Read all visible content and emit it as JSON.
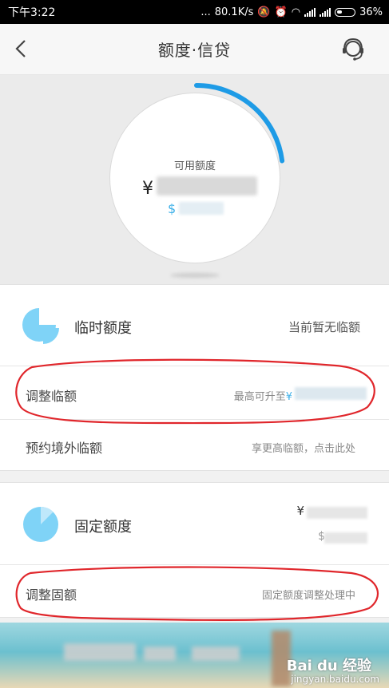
{
  "status_bar": {
    "time": "下午3:22",
    "dots": "...",
    "speed": "80.1K/s",
    "battery": "36%"
  },
  "header": {
    "title": "额度·信贷",
    "back_icon": "chevron-left-icon",
    "service_icon": "customer-service-icon"
  },
  "hero": {
    "label": "可用额度",
    "currency_cny": "¥",
    "currency_usd": "$",
    "usage_fraction": 0.23,
    "arc_color": "#1e9be6"
  },
  "temporary_limit": {
    "title": "临时额度",
    "status": "当前暂无临额",
    "icon_color": "#7fd3f7",
    "adjust": {
      "label": "调整临额",
      "hint_prefix": "最高可升至",
      "hint_currency": "¥"
    },
    "overseas": {
      "label": "预约境外临额",
      "hint": "享更高临额，点击此处"
    }
  },
  "fixed_limit": {
    "title": "固定额度",
    "currency_cny": "¥",
    "currency_usd": "$",
    "icon_color": "#7fd3f7",
    "adjust": {
      "label": "调整固额",
      "hint": "固定额度调整处理中"
    }
  },
  "banner": {
    "watermark": "Bai du 经验",
    "watermark_sub": "jingyan.baidu.com"
  },
  "annotation_color": "#e0262b"
}
